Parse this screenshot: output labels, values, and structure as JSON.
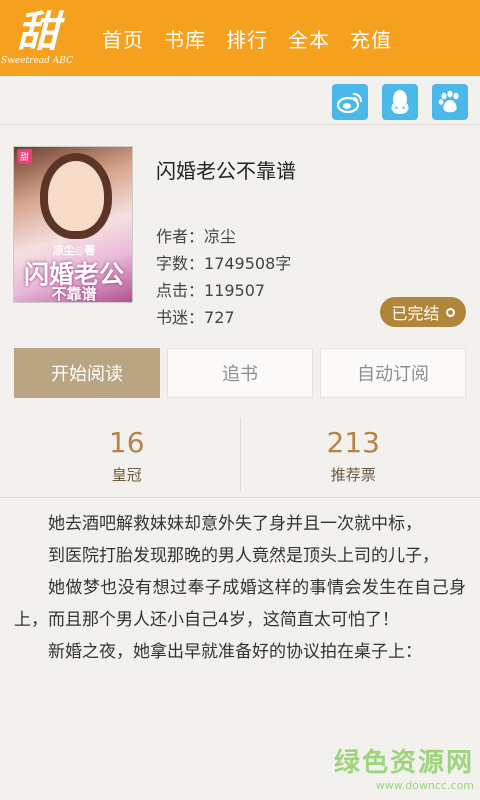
{
  "app": {
    "logo_text": "甜",
    "logo_subtext": "Sweetread ABC"
  },
  "nav": {
    "items": [
      {
        "label": "首页"
      },
      {
        "label": "书库"
      },
      {
        "label": "排行"
      },
      {
        "label": "全本"
      },
      {
        "label": "充值"
      }
    ]
  },
  "share": {
    "icons": [
      "weibo-icon",
      "qq-icon",
      "baidu-icon"
    ],
    "color": "#4ab8e8"
  },
  "book": {
    "title": "闪婚老公不靠谱",
    "cover": {
      "tag": "甜",
      "author_line": "凉尘◎著",
      "title_line1": "闪婚老公",
      "title_line2": "不靠谱"
    },
    "author_label": "作者：",
    "author": "凉尘",
    "words_label": "字数：",
    "words": "1749508字",
    "clicks_label": "点击：",
    "clicks": "119507",
    "fans_label": "书迷：",
    "fans": "727",
    "status": "已完结"
  },
  "actions": {
    "read": "开始阅读",
    "follow": "追书",
    "auto_subscribe": "自动订阅"
  },
  "stats": {
    "crowns": "16",
    "crowns_label": "皇冠",
    "votes": "213",
    "votes_label": "推荐票"
  },
  "description": {
    "paragraphs": [
      "她去酒吧解救妹妹却意外失了身并且一次就中标，",
      "到医院打胎发现那晚的男人竟然是顶头上司的儿子，",
      "她做梦也没有想过奉子成婚这样的事情会发生在自己身上，而且那个男人还小自己4岁，这简直太可怕了！",
      "新婚之夜，她拿出早就准备好的协议拍在桌子上："
    ]
  },
  "watermark": {
    "main": "绿色资源网",
    "sub": "www.downcc.com"
  },
  "colors": {
    "topbar": "#f6a11d",
    "accent": "#b4834a",
    "primary_button": "#b9a582",
    "badge": "#b0873a"
  }
}
